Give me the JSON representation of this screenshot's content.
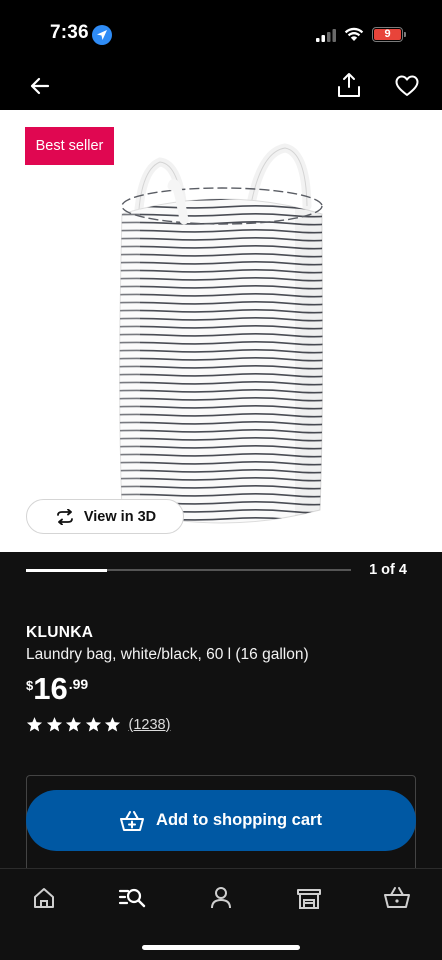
{
  "status_bar": {
    "time": "7:36",
    "battery_level": "9"
  },
  "product": {
    "badge": "Best seller",
    "view_3d_label": "View in 3D",
    "pager": {
      "label": "1 of 4",
      "current": 1,
      "total": 4
    },
    "name": "KLUNKA",
    "description": "Laundry bag, white/black, 60 l (16 gallon)",
    "price": {
      "currency": "$",
      "whole": "16",
      "cents": ".99"
    },
    "rating": {
      "stars": 5,
      "review_count": "(1238)"
    },
    "add_to_cart_label": "Add to shopping cart"
  },
  "top_nav": {
    "icons": [
      "back-arrow-icon",
      "share-icon",
      "heart-icon"
    ]
  },
  "tab_bar": {
    "tabs": [
      "home-icon",
      "search-icon",
      "account-icon",
      "store-icon",
      "cart-icon"
    ]
  },
  "colors": {
    "background": "#111111",
    "badge": "#e00751",
    "primary_button": "#0058a3",
    "location_icon": "#2f8cf6",
    "battery_low": "#e8443a"
  }
}
